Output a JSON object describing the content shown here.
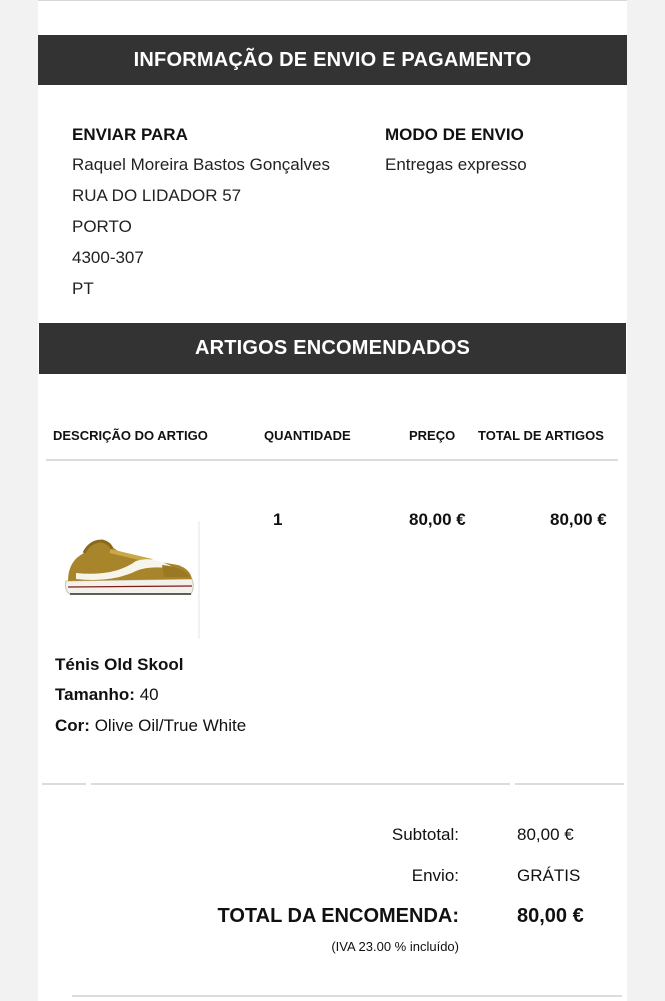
{
  "shipping_section": {
    "title": "INFORMAÇÃO DE ENVIO E PAGAMENTO",
    "ship_to_label": "ENVIAR PARA",
    "address": [
      "Raquel Moreira Bastos Gonçalves",
      "RUA DO LIDADOR 57",
      "PORTO",
      "4300-307",
      "PT"
    ],
    "mode_label": "MODO DE ENVIO",
    "mode_value": "Entregas expresso"
  },
  "items_section": {
    "title": "ARTIGOS ENCOMENDADOS",
    "columns": [
      "DESCRIÇÃO DO ARTIGO",
      "QUANTIDADE",
      "PREÇO",
      "TOTAL DE ARTIGOS"
    ],
    "item": {
      "image": "sneaker-image",
      "quantity": "1",
      "price": "80,00 €",
      "total": "80,00 €",
      "name": "Ténis Old Skool",
      "size_label": "Tamanho:",
      "size_value": "40",
      "color_label": "Cor:",
      "color_value": "Olive Oil/True White"
    }
  },
  "totals": {
    "subtotal_label": "Subtotal:",
    "subtotal_value": "80,00 €",
    "shipping_label": "Envio:",
    "shipping_value": "GRÁTIS",
    "grand_label": "TOTAL DA ENCOMENDA:",
    "grand_value": "80,00 €",
    "tax_note": "(IVA 23.00 % incluído)"
  },
  "colors": {
    "header_bar": "#333333",
    "page_bg": "#ffffff",
    "outer_bg": "#f2f2f2",
    "shoe_suede": "#a8852b"
  }
}
